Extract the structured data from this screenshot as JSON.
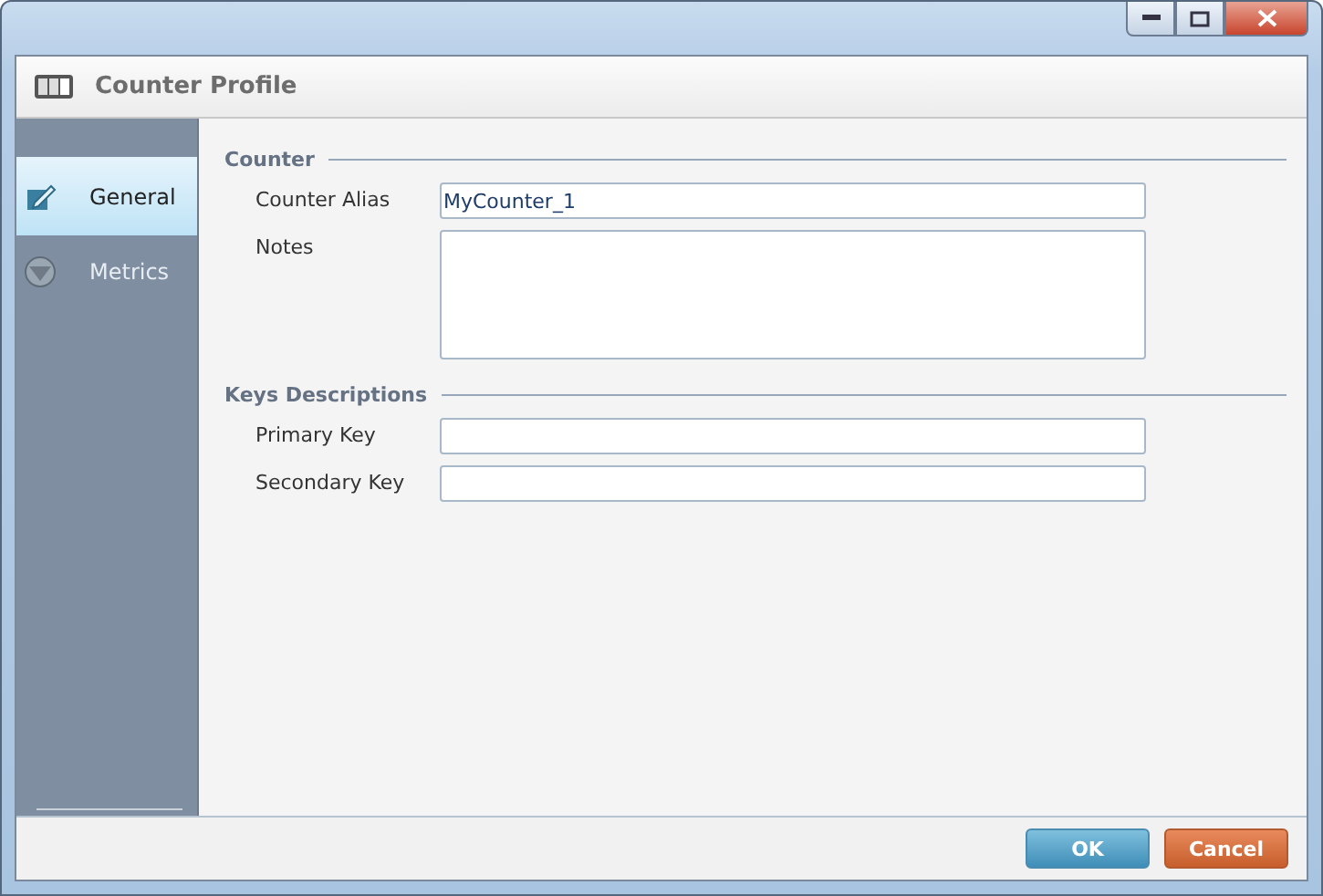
{
  "window": {
    "title": "Counter Profile"
  },
  "sidebar": {
    "items": [
      {
        "label": "General",
        "selected": true,
        "kind": "edit"
      },
      {
        "label": "Metrics",
        "selected": false,
        "kind": "funnel"
      }
    ]
  },
  "sections": [
    {
      "title": "Counter",
      "fields": [
        {
          "label": "Counter Alias",
          "kind": "line",
          "value": "MyCounter_1"
        },
        {
          "label": "Notes",
          "kind": "area"
        }
      ]
    },
    {
      "title": "Keys Descriptions",
      "fields": [
        {
          "label": "Primary Key",
          "kind": "line"
        },
        {
          "label": "Secondary Key",
          "kind": "line"
        }
      ]
    }
  ],
  "buttons": [
    {
      "label": "OK",
      "kind": "primary"
    },
    {
      "label": "Cancel",
      "kind": "cancel"
    }
  ]
}
